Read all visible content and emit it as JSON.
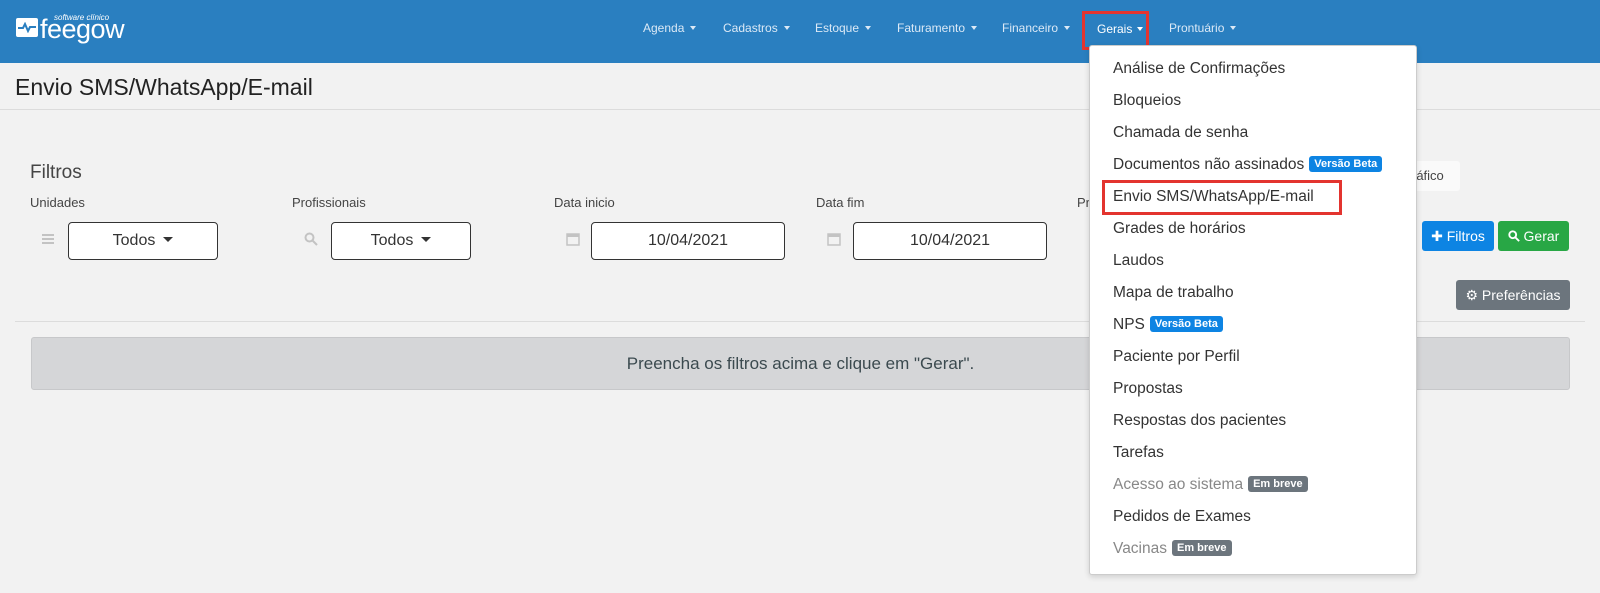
{
  "brand": {
    "small": "software clínico",
    "name": "feegow"
  },
  "nav": [
    {
      "label": "Agenda"
    },
    {
      "label": "Cadastros"
    },
    {
      "label": "Estoque"
    },
    {
      "label": "Faturamento"
    },
    {
      "label": "Financeiro"
    },
    {
      "label": "Gerais"
    },
    {
      "label": "Prontuário"
    }
  ],
  "page": {
    "title": "Envio SMS/WhatsApp/E-mail"
  },
  "filters": {
    "title": "Filtros",
    "unidades": {
      "label": "Unidades",
      "value": "Todos"
    },
    "profissionais": {
      "label": "Profissionais",
      "value": "Todos"
    },
    "data_inicio": {
      "label": "Data inicio",
      "value": "10/04/2021"
    },
    "data_fim": {
      "label": "Data fim",
      "value": "10/04/2021"
    },
    "partial_label": "Pr",
    "grafico_partial": "ráfico"
  },
  "buttons": {
    "filtros": "Filtros",
    "gerar": "Gerar",
    "preferencias": "Preferências"
  },
  "alert": "Preencha os filtros acima e clique em \"Gerar\".",
  "dropdown": [
    {
      "label": "Análise de Confirmações"
    },
    {
      "label": "Bloqueios"
    },
    {
      "label": "Chamada de senha"
    },
    {
      "label": "Documentos não assinados",
      "badge": "Versão Beta"
    },
    {
      "label": "Envio SMS/WhatsApp/E-mail"
    },
    {
      "label": "Grades de horários"
    },
    {
      "label": "Laudos"
    },
    {
      "label": "Mapa de trabalho"
    },
    {
      "label": "NPS",
      "badge": "Versão Beta"
    },
    {
      "label": "Paciente por Perfil"
    },
    {
      "label": "Propostas"
    },
    {
      "label": "Respostas dos pacientes"
    },
    {
      "label": "Tarefas"
    },
    {
      "label": "Acesso ao sistema",
      "badge": "Em breve"
    },
    {
      "label": "Pedidos de Exames"
    },
    {
      "label": "Vacinas",
      "badge": "Em breve"
    }
  ],
  "colors": {
    "topbar": "#2a7fc0",
    "highlight": "#e3342f",
    "beta_badge": "#0d84e3",
    "soon_badge": "#6c757d"
  }
}
